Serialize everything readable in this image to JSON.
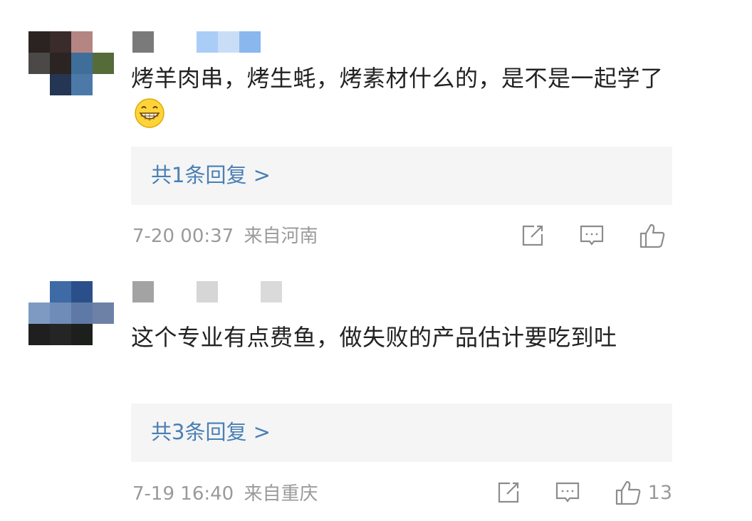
{
  "comments": [
    {
      "text": "烤羊肉串，烤生蚝，烤素材什么的，是不是一起学了",
      "emoji": "grinning-face-emoji",
      "replies_label": "共1条回复 >",
      "date": "7-20 00:37",
      "location": "来自河南",
      "like_count": ""
    },
    {
      "text": "这个专业有点费鱼，做失败的产品估计要吃到吐",
      "replies_label": "共3条回复 >",
      "date": "7-19 16:40",
      "location": "来自重庆",
      "like_count": "13"
    }
  ],
  "icons": {
    "share": "share-icon",
    "comment": "comment-icon",
    "like": "thumbs-up-icon"
  },
  "colors": {
    "link": "#4a7fb5",
    "meta": "#9a9a9a",
    "reply_bg": "#f5f5f5",
    "text": "#222222"
  }
}
